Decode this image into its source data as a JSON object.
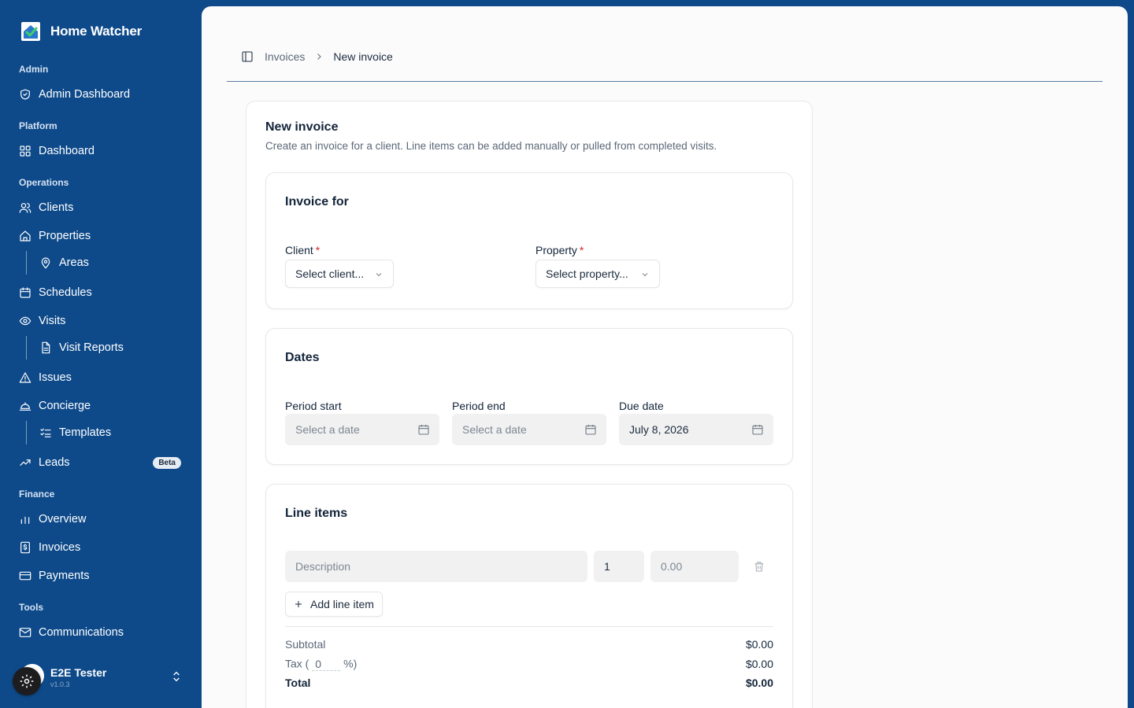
{
  "app": {
    "name": "Home Watcher"
  },
  "sidebar": {
    "sections": {
      "admin": "Admin",
      "platform": "Platform",
      "operations": "Operations",
      "finance": "Finance",
      "tools": "Tools"
    },
    "items": {
      "admin_dashboard": {
        "label": "Admin Dashboard",
        "icon": "shield-check-icon"
      },
      "dashboard": {
        "label": "Dashboard",
        "icon": "grid-icon"
      },
      "clients": {
        "label": "Clients",
        "icon": "users-icon"
      },
      "properties": {
        "label": "Properties",
        "icon": "home-icon"
      },
      "areas": {
        "label": "Areas",
        "icon": "map-pin-icon"
      },
      "schedules": {
        "label": "Schedules",
        "icon": "calendar-icon"
      },
      "visits": {
        "label": "Visits",
        "icon": "eye-icon"
      },
      "visit_reports": {
        "label": "Visit Reports",
        "icon": "file-text-icon"
      },
      "issues": {
        "label": "Issues",
        "icon": "alert-triangle-icon"
      },
      "concierge": {
        "label": "Concierge",
        "icon": "bell-concierge-icon"
      },
      "templates": {
        "label": "Templates",
        "icon": "list-checks-icon"
      },
      "leads": {
        "label": "Leads",
        "icon": "trending-up-icon",
        "badge": "Beta"
      },
      "overview": {
        "label": "Overview",
        "icon": "bar-chart-icon"
      },
      "invoices": {
        "label": "Invoices",
        "icon": "receipt-icon"
      },
      "payments": {
        "label": "Payments",
        "icon": "credit-card-icon"
      },
      "communications": {
        "label": "Communications",
        "icon": "mail-icon"
      }
    },
    "user": {
      "name": "E2E Tester",
      "version": "v1.0.3"
    }
  },
  "breadcrumb": {
    "parent": "Invoices",
    "current": "New invoice"
  },
  "form": {
    "title": "New invoice",
    "description": "Create an invoice for a client. Line items can be added manually or pulled from completed visits.",
    "invoice_for": {
      "title": "Invoice for",
      "client_label": "Client",
      "client_placeholder": "Select client...",
      "property_label": "Property",
      "property_placeholder": "Select property...",
      "required_mark": "*"
    },
    "dates": {
      "title": "Dates",
      "period_start_label": "Period start",
      "period_start_placeholder": "Select a date",
      "period_end_label": "Period end",
      "period_end_placeholder": "Select a date",
      "due_date_label": "Due date",
      "due_date_value": "July 8, 2026"
    },
    "line_items": {
      "title": "Line items",
      "description_placeholder": "Description",
      "quantity_value": "1",
      "price_placeholder": "0.00",
      "add_label": "Add line item"
    },
    "summary": {
      "subtotal_label": "Subtotal",
      "subtotal_value": "$0.00",
      "tax_label_prefix": "Tax (",
      "tax_rate": "0",
      "tax_label_suffix": "%)",
      "tax_value": "$0.00",
      "total_label": "Total",
      "total_value": "$0.00"
    }
  },
  "colors": {
    "sidebar_bg": "#0e4a8a",
    "panel_bg": "#fbfbfc",
    "required": "#d62828"
  }
}
